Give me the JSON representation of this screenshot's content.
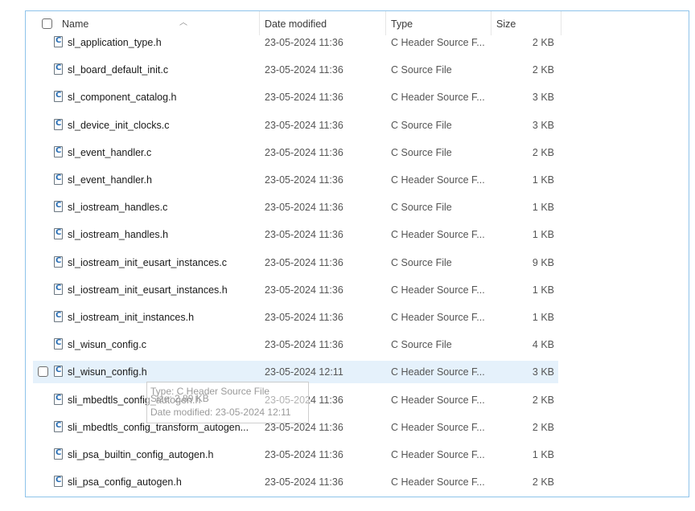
{
  "columns": {
    "name": "Name",
    "date_modified": "Date modified",
    "type": "Type",
    "size": "Size"
  },
  "files": [
    {
      "name": "sl_application_type.h",
      "date": "23-05-2024 11:36",
      "type": "C Header Source F...",
      "size": "2 KB",
      "icon": "c-file-icon"
    },
    {
      "name": "sl_board_default_init.c",
      "date": "23-05-2024 11:36",
      "type": "C Source File",
      "size": "2 KB",
      "icon": "c-file-icon"
    },
    {
      "name": "sl_component_catalog.h",
      "date": "23-05-2024 11:36",
      "type": "C Header Source F...",
      "size": "3 KB",
      "icon": "c-file-icon"
    },
    {
      "name": "sl_device_init_clocks.c",
      "date": "23-05-2024 11:36",
      "type": "C Source File",
      "size": "3 KB",
      "icon": "c-file-icon"
    },
    {
      "name": "sl_event_handler.c",
      "date": "23-05-2024 11:36",
      "type": "C Source File",
      "size": "2 KB",
      "icon": "c-file-icon"
    },
    {
      "name": "sl_event_handler.h",
      "date": "23-05-2024 11:36",
      "type": "C Header Source F...",
      "size": "1 KB",
      "icon": "c-file-icon"
    },
    {
      "name": "sl_iostream_handles.c",
      "date": "23-05-2024 11:36",
      "type": "C Source File",
      "size": "1 KB",
      "icon": "c-file-icon"
    },
    {
      "name": "sl_iostream_handles.h",
      "date": "23-05-2024 11:36",
      "type": "C Header Source F...",
      "size": "1 KB",
      "icon": "c-file-icon"
    },
    {
      "name": "sl_iostream_init_eusart_instances.c",
      "date": "23-05-2024 11:36",
      "type": "C Source File",
      "size": "9 KB",
      "icon": "c-file-icon"
    },
    {
      "name": "sl_iostream_init_eusart_instances.h",
      "date": "23-05-2024 11:36",
      "type": "C Header Source F...",
      "size": "1 KB",
      "icon": "c-file-icon"
    },
    {
      "name": "sl_iostream_init_instances.h",
      "date": "23-05-2024 11:36",
      "type": "C Header Source F...",
      "size": "1 KB",
      "icon": "c-file-icon"
    },
    {
      "name": "sl_wisun_config.c",
      "date": "23-05-2024 11:36",
      "type": "C Source File",
      "size": "4 KB",
      "icon": "c-file-icon"
    },
    {
      "name": "sl_wisun_config.h",
      "date": "23-05-2024 12:11",
      "type": "C Header Source F...",
      "size": "3 KB",
      "icon": "c-file-icon",
      "hovered": true
    },
    {
      "name": "sli_mbedtls_config_autogen.h",
      "date": "23-05-2024 11:36",
      "type": "C Header Source F...",
      "size": "2 KB",
      "icon": "c-file-icon"
    },
    {
      "name": "sli_mbedtls_config_transform_autogen...",
      "date": "23-05-2024 11:36",
      "type": "C Header Source F...",
      "size": "2 KB",
      "icon": "c-file-icon"
    },
    {
      "name": "sli_psa_builtin_config_autogen.h",
      "date": "23-05-2024 11:36",
      "type": "C Header Source F...",
      "size": "1 KB",
      "icon": "c-file-icon"
    },
    {
      "name": "sli_psa_config_autogen.h",
      "date": "23-05-2024 11:36",
      "type": "C Header Source F...",
      "size": "2 KB",
      "icon": "c-file-icon"
    }
  ],
  "tooltip": {
    "type": "Type: C Header Source File",
    "size": "Size: 2.89 KB",
    "date": "Date modified: 23-05-2024 12:11"
  },
  "colors": {
    "frame_border": "#8ec3ea",
    "selection": "#e5f1fb",
    "icon_letter": "#2a6fb5"
  }
}
